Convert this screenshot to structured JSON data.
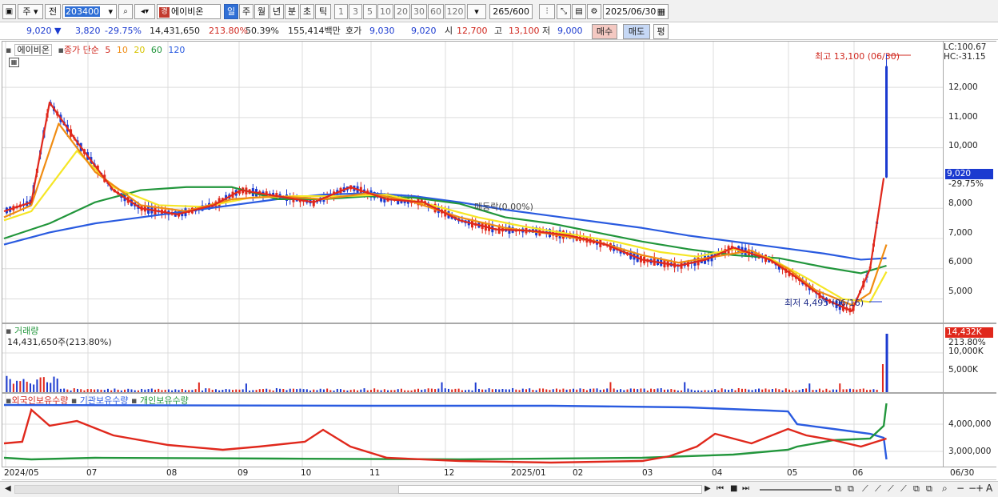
{
  "toolbar": {
    "period": "주",
    "prev_label": "전",
    "code": "203400",
    "stock_name": "에이비온",
    "stock_badge": "경",
    "periods": [
      "일",
      "주",
      "월",
      "년",
      "분",
      "초",
      "틱"
    ],
    "intervals": [
      "1",
      "3",
      "5",
      "10",
      "20",
      "30",
      "60",
      "120"
    ],
    "count": "265",
    "count_max": "/600",
    "date": "2025/06/30"
  },
  "info": {
    "price": "9,020",
    "change": "3,820",
    "change_pct": "-29.75%",
    "volume": "14,431,650",
    "volume_ratio": "213.80%",
    "turnover": "50.39%",
    "amount": "155,414백만",
    "bid_label": "호가",
    "bid1": "9,030",
    "bid2": "9,020",
    "open_label": "시",
    "open": "12,700",
    "high_label": "고",
    "high": "13,100",
    "low_label": "저",
    "low": "9,000",
    "buy_label": "매수",
    "sell_label": "매도",
    "pyeong_label": "평"
  },
  "price_panel": {
    "legend": {
      "name": "에이비온",
      "ma_label": "종가 단순",
      "ma5": "5",
      "ma10": "10",
      "ma20": "20",
      "ma60": "60",
      "ma120": "120"
    },
    "high_annot": "최고 13,100 (06/30)",
    "low_annot": "최저 4,495 (06/16)",
    "event_annot": "매등락(0.00%)",
    "lc": "LC:100.67",
    "hc": "HC:-31.15",
    "current_price": "9,020",
    "current_pct": "-29.75%",
    "y_ticks": [
      "12,000",
      "11,000",
      "10,000",
      "9,000",
      "8,000",
      "7,000",
      "6,000",
      "5,000"
    ]
  },
  "volume_panel": {
    "title": "거래량",
    "value": "14,431,650주(213.80%)",
    "current": "14,432K",
    "current_pct": "213.80%",
    "y_ticks": [
      "10,000K",
      "5,000K"
    ]
  },
  "holding_panel": {
    "legend": [
      "외국인보유수량",
      "기관보유수량",
      "개인보유수량"
    ],
    "y_ticks": [
      "4,000,000",
      "3,000,000"
    ]
  },
  "x_axis": {
    "labels": [
      "2024/05",
      "07",
      "08",
      "09",
      "10",
      "11",
      "12",
      "2025/01",
      "02",
      "03",
      "04",
      "05",
      "06"
    ],
    "end_label": "06/30"
  },
  "colors": {
    "up": "#e0281c",
    "down": "#1b3ad0",
    "ma5": "#e0281c",
    "ma10": "#f08c12",
    "ma20": "#f5e626",
    "ma60": "#22963c",
    "ma120": "#2a5be0"
  },
  "chart_data": {
    "type": "candlestick",
    "x_range": [
      "2024/05",
      "2025/06/30"
    ],
    "y_range": [
      4300,
      13300
    ],
    "ma_close_approx": {
      "ma5_points": [
        [
          0,
          7900
        ],
        [
          3,
          8200
        ],
        [
          5,
          11500
        ],
        [
          8,
          10200
        ],
        [
          12,
          8600
        ],
        [
          15,
          8000
        ],
        [
          19,
          7800
        ],
        [
          23,
          8100
        ],
        [
          26,
          8600
        ],
        [
          30,
          8400
        ],
        [
          34,
          8200
        ],
        [
          38,
          8700
        ],
        [
          42,
          8300
        ],
        [
          46,
          8200
        ],
        [
          50,
          7600
        ],
        [
          54,
          7300
        ],
        [
          58,
          7250
        ],
        [
          62,
          7100
        ],
        [
          66,
          6800
        ],
        [
          70,
          6300
        ],
        [
          74,
          6100
        ],
        [
          77,
          6300
        ],
        [
          80,
          6700
        ],
        [
          84,
          6300
        ],
        [
          87,
          5700
        ],
        [
          90,
          5000
        ],
        [
          93,
          4600
        ],
        [
          95,
          6000
        ],
        [
          96.5,
          9000
        ]
      ],
      "ma10_points": [
        [
          0,
          7700
        ],
        [
          3,
          8100
        ],
        [
          6,
          10800
        ],
        [
          10,
          9200
        ],
        [
          15,
          8100
        ],
        [
          20,
          7900
        ],
        [
          25,
          8300
        ],
        [
          30,
          8400
        ],
        [
          35,
          8300
        ],
        [
          40,
          8500
        ],
        [
          45,
          8200
        ],
        [
          50,
          7700
        ],
        [
          55,
          7350
        ],
        [
          60,
          7150
        ],
        [
          65,
          6900
        ],
        [
          70,
          6450
        ],
        [
          74,
          6200
        ],
        [
          78,
          6400
        ],
        [
          82,
          6600
        ],
        [
          86,
          6000
        ],
        [
          89,
          5300
        ],
        [
          93,
          4800
        ],
        [
          95,
          5200
        ],
        [
          96.8,
          6800
        ]
      ],
      "ma20_points": [
        [
          0,
          7600
        ],
        [
          3,
          7900
        ],
        [
          8,
          9900
        ],
        [
          12,
          8700
        ],
        [
          17,
          8100
        ],
        [
          22,
          8050
        ],
        [
          27,
          8350
        ],
        [
          32,
          8400
        ],
        [
          37,
          8400
        ],
        [
          42,
          8450
        ],
        [
          47,
          8100
        ],
        [
          52,
          7700
        ],
        [
          57,
          7400
        ],
        [
          62,
          7150
        ],
        [
          67,
          6900
        ],
        [
          72,
          6550
        ],
        [
          76,
          6400
        ],
        [
          80,
          6650
        ],
        [
          84,
          6350
        ],
        [
          88,
          5700
        ],
        [
          92,
          5000
        ],
        [
          95,
          4900
        ],
        [
          96.8,
          5900
        ]
      ],
      "ma60_points": [
        [
          0,
          7000
        ],
        [
          5,
          7500
        ],
        [
          10,
          8200
        ],
        [
          15,
          8600
        ],
        [
          20,
          8700
        ],
        [
          25,
          8700
        ],
        [
          30,
          8300
        ],
        [
          35,
          8300
        ],
        [
          40,
          8400
        ],
        [
          45,
          8350
        ],
        [
          50,
          8150
        ],
        [
          55,
          7700
        ],
        [
          60,
          7500
        ],
        [
          65,
          7200
        ],
        [
          70,
          6900
        ],
        [
          75,
          6650
        ],
        [
          80,
          6450
        ],
        [
          85,
          6350
        ],
        [
          90,
          6050
        ],
        [
          94,
          5850
        ],
        [
          96.8,
          6100
        ]
      ],
      "ma120_points": [
        [
          0,
          6800
        ],
        [
          5,
          7200
        ],
        [
          10,
          7500
        ],
        [
          15,
          7700
        ],
        [
          20,
          7900
        ],
        [
          25,
          8100
        ],
        [
          30,
          8300
        ],
        [
          35,
          8450
        ],
        [
          40,
          8500
        ],
        [
          45,
          8400
        ],
        [
          50,
          8200
        ],
        [
          55,
          7950
        ],
        [
          60,
          7750
        ],
        [
          65,
          7550
        ],
        [
          70,
          7350
        ],
        [
          75,
          7100
        ],
        [
          80,
          6900
        ],
        [
          85,
          6700
        ],
        [
          90,
          6500
        ],
        [
          94,
          6300
        ],
        [
          96.8,
          6350
        ]
      ]
    },
    "events": [
      {
        "label": "최고 13,100 (06/30)",
        "value": 13100
      },
      {
        "label": "최저 4,495 (06/16)",
        "value": 4495
      }
    ]
  }
}
